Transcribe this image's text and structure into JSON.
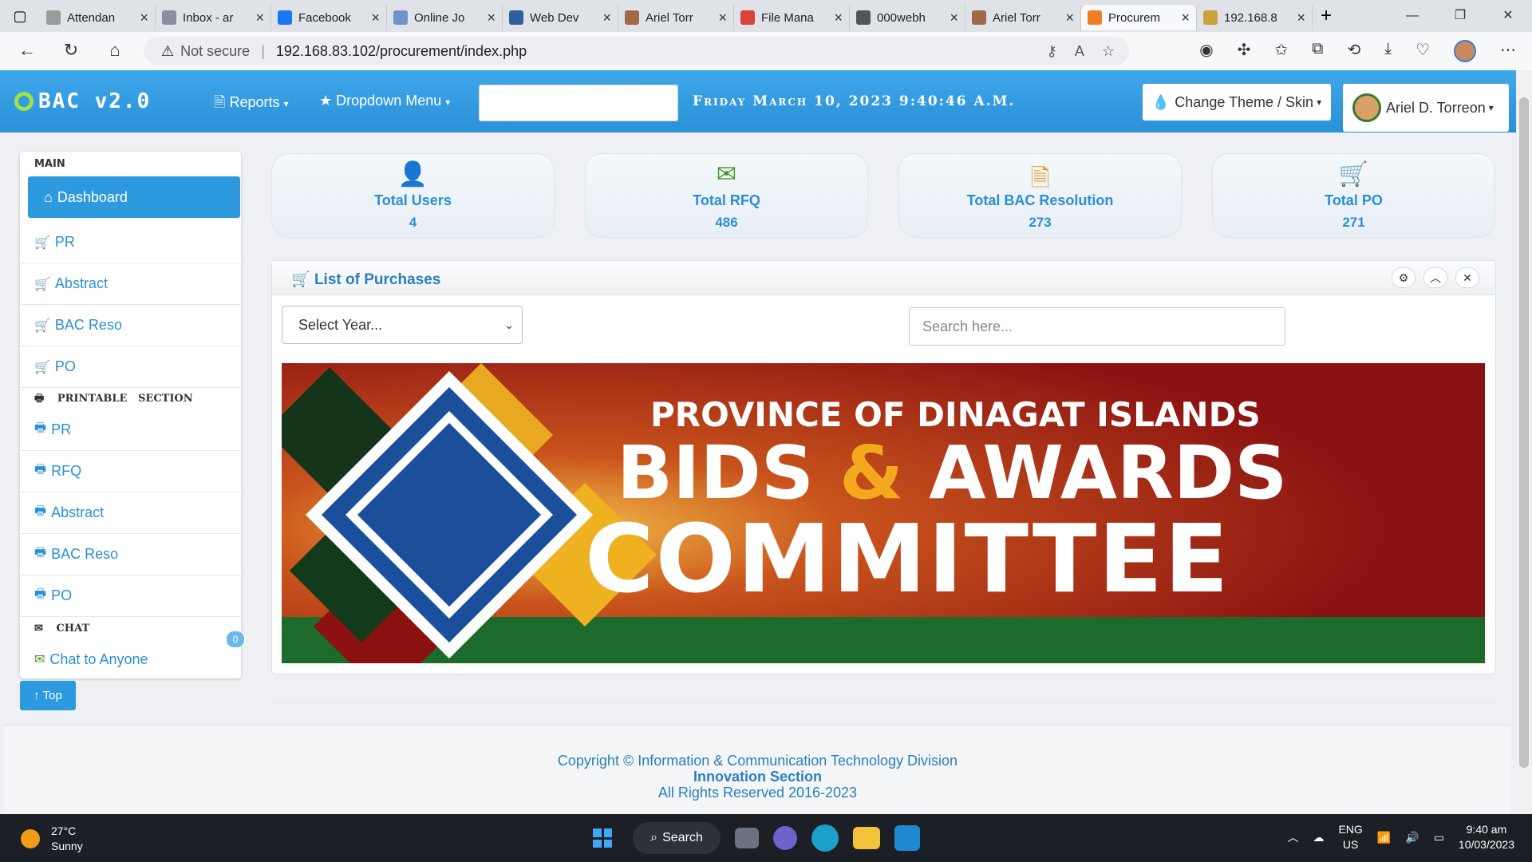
{
  "browser": {
    "tabs": [
      {
        "label": "Attendan",
        "color": "#9b9b9b"
      },
      {
        "label": "Inbox - ar",
        "color": "#8a8fa0"
      },
      {
        "label": "Facebook",
        "color": "#1877f2"
      },
      {
        "label": "Online Jo",
        "color": "#6f93c9"
      },
      {
        "label": "Web Dev",
        "color": "#2f5f9e"
      },
      {
        "label": "Ariel Torr",
        "color": "#a06a48"
      },
      {
        "label": "File Mana",
        "color": "#d9413b"
      },
      {
        "label": "000webh",
        "color": "#555"
      },
      {
        "label": "Ariel Torr",
        "color": "#a06a48"
      },
      {
        "label": "Procurem",
        "color": "#f07c26"
      },
      {
        "label": "192.168.8",
        "color": "#c9a43a"
      }
    ],
    "active_tab_index": 9,
    "security_label": "Not secure",
    "url": "192.168.83.102/procurement/index.php"
  },
  "navbar": {
    "brand": "BAC v2.0",
    "reports_label": "Reports",
    "dropdown_label": "Dropdown Menu",
    "datetime": "Friday March 10, 2023 9:40:46 A.M.",
    "theme_label": "Change Theme / Skin",
    "user_name": "Ariel D. Torreon",
    "accent_color": "#2d9ae0"
  },
  "sidebar": {
    "main_heading": "MAIN",
    "dashboard_label": "Dashboard",
    "main_items": [
      "PR",
      "Abstract",
      "BAC Reso",
      "PO"
    ],
    "printable_heading": "PRINTABLE   SECTION",
    "printable_items": [
      "PR",
      "RFQ",
      "Abstract",
      "BAC Reso",
      "PO"
    ],
    "chat_heading": "CHAT",
    "chat_item": "Chat to Anyone",
    "chat_badge": "0",
    "top_button": "Top"
  },
  "stats": [
    {
      "title": "Total Users",
      "value": "4",
      "icon": "user-icon",
      "color": "#2a8fd6"
    },
    {
      "title": "Total RFQ",
      "value": "486",
      "icon": "envelope-icon",
      "color": "#4a9a2a"
    },
    {
      "title": "Total BAC Resolution",
      "value": "273",
      "icon": "file-icon",
      "color": "#f39a1a"
    },
    {
      "title": "Total PO",
      "value": "271",
      "icon": "cart-icon",
      "color": "#e0413d"
    }
  ],
  "panel": {
    "title": "List of Purchases",
    "year_select_placeholder": "Select Year...",
    "search_placeholder": "Search here..."
  },
  "banner": {
    "line1": "PROVINCE OF DINAGAT ISLANDS",
    "line2_a": "BIDS",
    "line2_amp": "&",
    "line2_b": "AWARDS",
    "line3": "COMMITTEE"
  },
  "footer": {
    "line1": "Copyright © Information & Communication Technology Division",
    "line2": "Innovation Section",
    "line3": "All Rights Reserved 2016-2023"
  },
  "taskbar": {
    "temperature": "27°C",
    "weather": "Sunny",
    "search_label": "Search",
    "lang_line1": "ENG",
    "lang_line2": "US",
    "time": "9:40 am",
    "date": "10/03/2023"
  }
}
